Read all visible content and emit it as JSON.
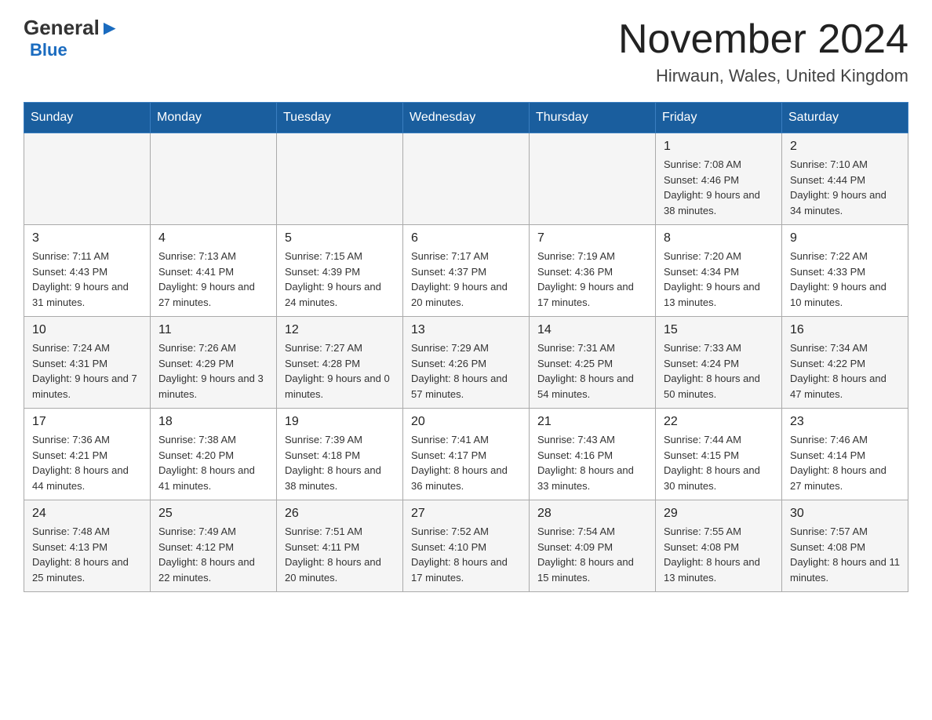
{
  "header": {
    "logo": {
      "general": "General",
      "blue": "Blue",
      "triangle_color": "#1a6bbf"
    },
    "title": "November 2024",
    "location": "Hirwaun, Wales, United Kingdom"
  },
  "calendar": {
    "days_of_week": [
      "Sunday",
      "Monday",
      "Tuesday",
      "Wednesday",
      "Thursday",
      "Friday",
      "Saturday"
    ],
    "weeks": [
      [
        {
          "day": "",
          "info": ""
        },
        {
          "day": "",
          "info": ""
        },
        {
          "day": "",
          "info": ""
        },
        {
          "day": "",
          "info": ""
        },
        {
          "day": "",
          "info": ""
        },
        {
          "day": "1",
          "info": "Sunrise: 7:08 AM\nSunset: 4:46 PM\nDaylight: 9 hours and 38 minutes."
        },
        {
          "day": "2",
          "info": "Sunrise: 7:10 AM\nSunset: 4:44 PM\nDaylight: 9 hours and 34 minutes."
        }
      ],
      [
        {
          "day": "3",
          "info": "Sunrise: 7:11 AM\nSunset: 4:43 PM\nDaylight: 9 hours and 31 minutes."
        },
        {
          "day": "4",
          "info": "Sunrise: 7:13 AM\nSunset: 4:41 PM\nDaylight: 9 hours and 27 minutes."
        },
        {
          "day": "5",
          "info": "Sunrise: 7:15 AM\nSunset: 4:39 PM\nDaylight: 9 hours and 24 minutes."
        },
        {
          "day": "6",
          "info": "Sunrise: 7:17 AM\nSunset: 4:37 PM\nDaylight: 9 hours and 20 minutes."
        },
        {
          "day": "7",
          "info": "Sunrise: 7:19 AM\nSunset: 4:36 PM\nDaylight: 9 hours and 17 minutes."
        },
        {
          "day": "8",
          "info": "Sunrise: 7:20 AM\nSunset: 4:34 PM\nDaylight: 9 hours and 13 minutes."
        },
        {
          "day": "9",
          "info": "Sunrise: 7:22 AM\nSunset: 4:33 PM\nDaylight: 9 hours and 10 minutes."
        }
      ],
      [
        {
          "day": "10",
          "info": "Sunrise: 7:24 AM\nSunset: 4:31 PM\nDaylight: 9 hours and 7 minutes."
        },
        {
          "day": "11",
          "info": "Sunrise: 7:26 AM\nSunset: 4:29 PM\nDaylight: 9 hours and 3 minutes."
        },
        {
          "day": "12",
          "info": "Sunrise: 7:27 AM\nSunset: 4:28 PM\nDaylight: 9 hours and 0 minutes."
        },
        {
          "day": "13",
          "info": "Sunrise: 7:29 AM\nSunset: 4:26 PM\nDaylight: 8 hours and 57 minutes."
        },
        {
          "day": "14",
          "info": "Sunrise: 7:31 AM\nSunset: 4:25 PM\nDaylight: 8 hours and 54 minutes."
        },
        {
          "day": "15",
          "info": "Sunrise: 7:33 AM\nSunset: 4:24 PM\nDaylight: 8 hours and 50 minutes."
        },
        {
          "day": "16",
          "info": "Sunrise: 7:34 AM\nSunset: 4:22 PM\nDaylight: 8 hours and 47 minutes."
        }
      ],
      [
        {
          "day": "17",
          "info": "Sunrise: 7:36 AM\nSunset: 4:21 PM\nDaylight: 8 hours and 44 minutes."
        },
        {
          "day": "18",
          "info": "Sunrise: 7:38 AM\nSunset: 4:20 PM\nDaylight: 8 hours and 41 minutes."
        },
        {
          "day": "19",
          "info": "Sunrise: 7:39 AM\nSunset: 4:18 PM\nDaylight: 8 hours and 38 minutes."
        },
        {
          "day": "20",
          "info": "Sunrise: 7:41 AM\nSunset: 4:17 PM\nDaylight: 8 hours and 36 minutes."
        },
        {
          "day": "21",
          "info": "Sunrise: 7:43 AM\nSunset: 4:16 PM\nDaylight: 8 hours and 33 minutes."
        },
        {
          "day": "22",
          "info": "Sunrise: 7:44 AM\nSunset: 4:15 PM\nDaylight: 8 hours and 30 minutes."
        },
        {
          "day": "23",
          "info": "Sunrise: 7:46 AM\nSunset: 4:14 PM\nDaylight: 8 hours and 27 minutes."
        }
      ],
      [
        {
          "day": "24",
          "info": "Sunrise: 7:48 AM\nSunset: 4:13 PM\nDaylight: 8 hours and 25 minutes."
        },
        {
          "day": "25",
          "info": "Sunrise: 7:49 AM\nSunset: 4:12 PM\nDaylight: 8 hours and 22 minutes."
        },
        {
          "day": "26",
          "info": "Sunrise: 7:51 AM\nSunset: 4:11 PM\nDaylight: 8 hours and 20 minutes."
        },
        {
          "day": "27",
          "info": "Sunrise: 7:52 AM\nSunset: 4:10 PM\nDaylight: 8 hours and 17 minutes."
        },
        {
          "day": "28",
          "info": "Sunrise: 7:54 AM\nSunset: 4:09 PM\nDaylight: 8 hours and 15 minutes."
        },
        {
          "day": "29",
          "info": "Sunrise: 7:55 AM\nSunset: 4:08 PM\nDaylight: 8 hours and 13 minutes."
        },
        {
          "day": "30",
          "info": "Sunrise: 7:57 AM\nSunset: 4:08 PM\nDaylight: 8 hours and 11 minutes."
        }
      ]
    ]
  }
}
